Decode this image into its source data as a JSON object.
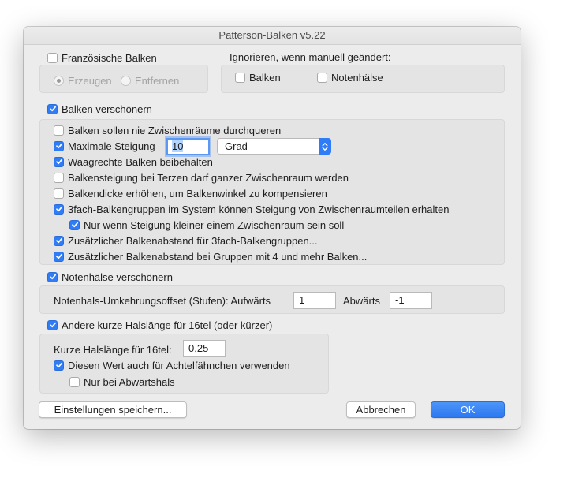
{
  "window": {
    "title": "Patterson-Balken v5.22"
  },
  "french": {
    "label": "Französische Balken",
    "checked": false,
    "options": [
      {
        "label": "Erzeugen",
        "selected": true
      },
      {
        "label": "Entfernen",
        "selected": false
      }
    ]
  },
  "ignore": {
    "label": "Ignorieren, wenn manuell geändert:",
    "beams_label": "Balken",
    "stems_label": "Notenhälse"
  },
  "beautify_beams": {
    "label": "Balken verschönern",
    "never_cross": "Balken sollen nie Zwischenräume durchqueren",
    "max_slope": "Maximale Steigung",
    "max_slope_value": "10",
    "slope_unit": "Grad",
    "keep_horizontal": "Waagrechte Balken beibehalten",
    "thirds_full_space": "Balkensteigung bei Terzen darf ganzer Zwischenraum werden",
    "thicken": "Balkendicke erhöhen, um Balkenwinkel zu kompensieren",
    "triple_groups": "3fach-Balkengruppen im System können Steigung von Zwischenraumteilen erhalten",
    "only_if_less": "Nur wenn Steigung kleiner einem Zwischenraum sein soll",
    "extra_triple": "Zusätzlicher Balkenabstand für 3fach-Balkengruppen...",
    "extra_four": "Zusätzlicher Balkenabstand bei Gruppen mit 4 und mehr Balken..."
  },
  "beautify_stems": {
    "label": "Notenhälse verschönern",
    "offset_label": "Notenhals-Umkehrungsoffset (Stufen): Aufwärts",
    "up_value": "1",
    "down_label": "Abwärts",
    "down_value": "-1"
  },
  "short_stems": {
    "label": "Andere kurze Halslänge für 16tel (oder kürzer)",
    "length_label": "Kurze Halslänge für 16tel:",
    "length_value": "0,25",
    "use_for_flags": "Diesen Wert auch für Achtelfähnchen verwenden",
    "only_down": "Nur bei Abwärtshals"
  },
  "buttons": {
    "save": "Einstellungen speichern...",
    "cancel": "Abbrechen",
    "ok": "OK"
  },
  "colors": {
    "accent": "#2f7cf6"
  }
}
